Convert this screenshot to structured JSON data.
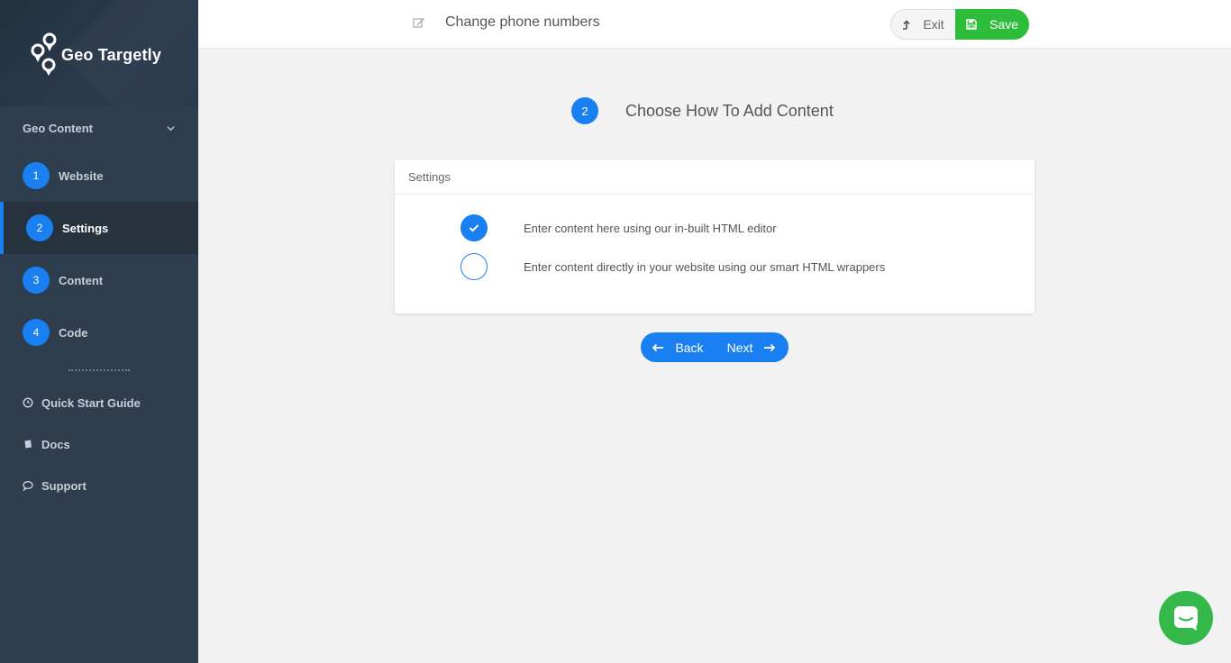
{
  "brand": {
    "name": "Geo Targetly"
  },
  "sidebar": {
    "section": "Geo Content",
    "steps": [
      {
        "num": "1",
        "label": "Website",
        "active": false
      },
      {
        "num": "2",
        "label": "Settings",
        "active": true
      },
      {
        "num": "3",
        "label": "Content",
        "active": false
      },
      {
        "num": "4",
        "label": "Code",
        "active": false
      }
    ],
    "links": [
      {
        "label": "Quick Start Guide",
        "icon": "clock-icon"
      },
      {
        "label": "Docs",
        "icon": "book-icon"
      },
      {
        "label": "Support",
        "icon": "comment-icon"
      }
    ]
  },
  "header": {
    "title": "Change phone numbers",
    "title_icon": "edit-icon",
    "exit_label": "Exit",
    "save_label": "Save"
  },
  "main": {
    "step_num": "2",
    "heading": "Choose How To Add Content",
    "card_title": "Settings",
    "options": [
      {
        "label": "Enter content here using our in-built HTML editor",
        "selected": true
      },
      {
        "label": "Enter content directly in your website using our smart HTML wrappers",
        "selected": false
      }
    ],
    "back_label": "Back",
    "next_label": "Next"
  },
  "colors": {
    "accent": "#1a7ff0",
    "save": "#2ebd3a",
    "sidebar": "#2f3e4e",
    "chat": "#34b84a"
  }
}
